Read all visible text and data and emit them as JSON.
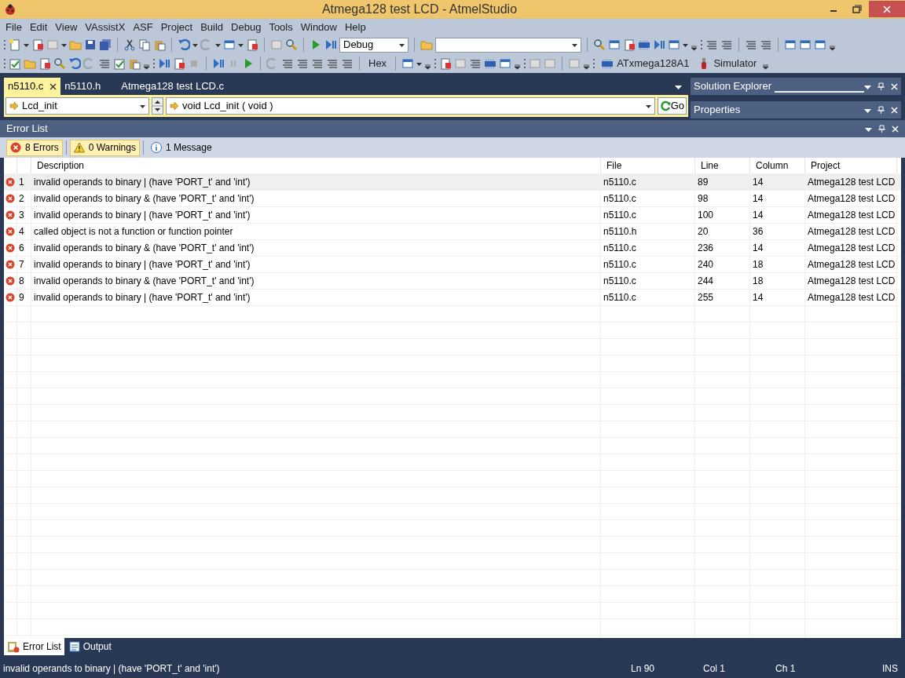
{
  "window": {
    "title": "Atmega128 test LCD - AtmelStudio"
  },
  "menu": [
    "File",
    "Edit",
    "View",
    "VAssistX",
    "ASF",
    "Project",
    "Build",
    "Debug",
    "Tools",
    "Window",
    "Help"
  ],
  "toolbar": {
    "configuration": "Debug",
    "hex_button": "Hex",
    "device": "ATxmega128A1",
    "tool": "Simulator"
  },
  "document_tabs": [
    {
      "label": "n5110.c",
      "selected": true
    },
    {
      "label": "n5110.h",
      "selected": false
    },
    {
      "label": "Atmega128 test LCD.c",
      "selected": false
    }
  ],
  "navigation": {
    "scope": "Lcd_init",
    "member": "void Lcd_init ( void )",
    "go_button": "Go"
  },
  "side_panels": [
    "Solution Explorer",
    "Properties"
  ],
  "error_list": {
    "title": "Error List",
    "filters": [
      {
        "kind": "error",
        "label": "8 Errors",
        "selected": true
      },
      {
        "kind": "warning",
        "label": "0 Warnings",
        "selected": true
      },
      {
        "kind": "message",
        "label": "1 Message",
        "selected": false
      }
    ],
    "columns": [
      "Description",
      "File",
      "Line",
      "Column",
      "Project"
    ],
    "rows": [
      {
        "number": "1",
        "description": "invalid operands to binary | (have 'PORT_t' and 'int')",
        "file": "n5110.c",
        "line": "89",
        "column": "14",
        "project": "Atmega128 test LCD",
        "selected": true
      },
      {
        "number": "2",
        "description": "invalid operands to binary & (have 'PORT_t' and 'int')",
        "file": "n5110.c",
        "line": "98",
        "column": "14",
        "project": "Atmega128 test LCD",
        "selected": false
      },
      {
        "number": "3",
        "description": "invalid operands to binary | (have 'PORT_t' and 'int')",
        "file": "n5110.c",
        "line": "100",
        "column": "14",
        "project": "Atmega128 test LCD",
        "selected": false
      },
      {
        "number": "4",
        "description": "called object is not a function or function pointer",
        "file": "n5110.h",
        "line": "20",
        "column": "36",
        "project": "Atmega128 test LCD",
        "selected": false
      },
      {
        "number": "6",
        "description": "invalid operands to binary & (have 'PORT_t' and 'int')",
        "file": "n5110.c",
        "line": "236",
        "column": "14",
        "project": "Atmega128 test LCD",
        "selected": false
      },
      {
        "number": "7",
        "description": "invalid operands to binary | (have 'PORT_t' and 'int')",
        "file": "n5110.c",
        "line": "240",
        "column": "18",
        "project": "Atmega128 test LCD",
        "selected": false
      },
      {
        "number": "8",
        "description": "invalid operands to binary & (have 'PORT_t' and 'int')",
        "file": "n5110.c",
        "line": "244",
        "column": "18",
        "project": "Atmega128 test LCD",
        "selected": false
      },
      {
        "number": "9",
        "description": "invalid operands to binary | (have 'PORT_t' and 'int')",
        "file": "n5110.c",
        "line": "255",
        "column": "14",
        "project": "Atmega128 test LCD",
        "selected": false
      }
    ]
  },
  "bottom_tabs": [
    {
      "label": "Error List",
      "selected": true
    },
    {
      "label": "Output",
      "selected": false
    }
  ],
  "status_bar": {
    "message": "invalid operands to binary | (have 'PORT_t' and 'int')",
    "line": "Ln 90",
    "col": "Col 1",
    "ch": "Ch 1",
    "mode": "INS"
  }
}
